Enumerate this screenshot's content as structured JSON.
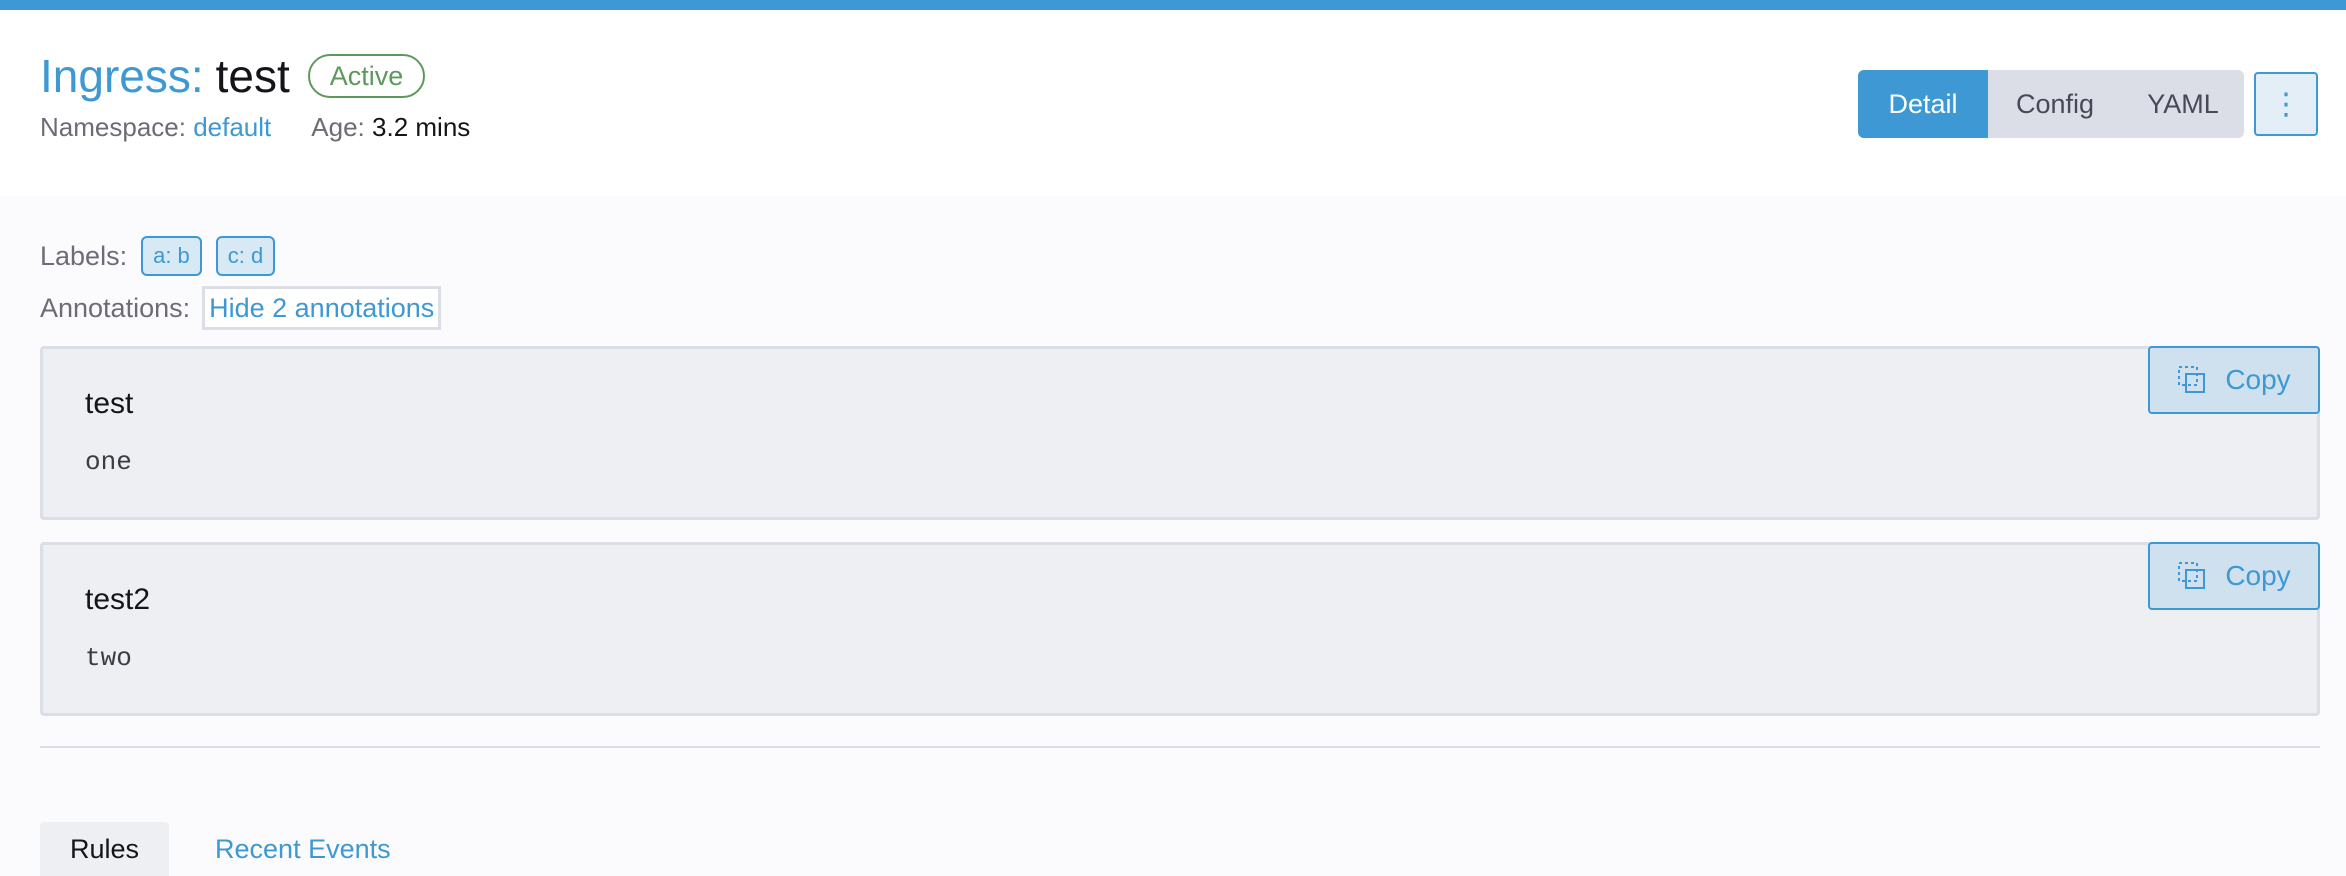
{
  "colors": {
    "accent": "#3d98d3",
    "active_badge": "#5d995d"
  },
  "header": {
    "kind": "Ingress:",
    "name": "test",
    "status": "Active",
    "namespace_label": "Namespace:",
    "namespace_value": "default",
    "age_label": "Age:",
    "age_value": "3.2 mins"
  },
  "view_tabs": [
    {
      "label": "Detail",
      "active": true
    },
    {
      "label": "Config",
      "active": false
    },
    {
      "label": "YAML",
      "active": false
    }
  ],
  "actions_menu_icon": "vertical-ellipsis-icon",
  "labels": {
    "caption": "Labels:",
    "items": [
      "a: b",
      "c: d"
    ]
  },
  "annotations": {
    "caption": "Annotations:",
    "toggle_label": "Hide 2 annotations",
    "items": [
      {
        "key": "test",
        "value": "one",
        "copy_label": "Copy"
      },
      {
        "key": "test2",
        "value": "two",
        "copy_label": "Copy"
      }
    ]
  },
  "bottom_tabs": [
    {
      "label": "Rules",
      "active": true
    },
    {
      "label": "Recent Events",
      "active": false
    }
  ]
}
